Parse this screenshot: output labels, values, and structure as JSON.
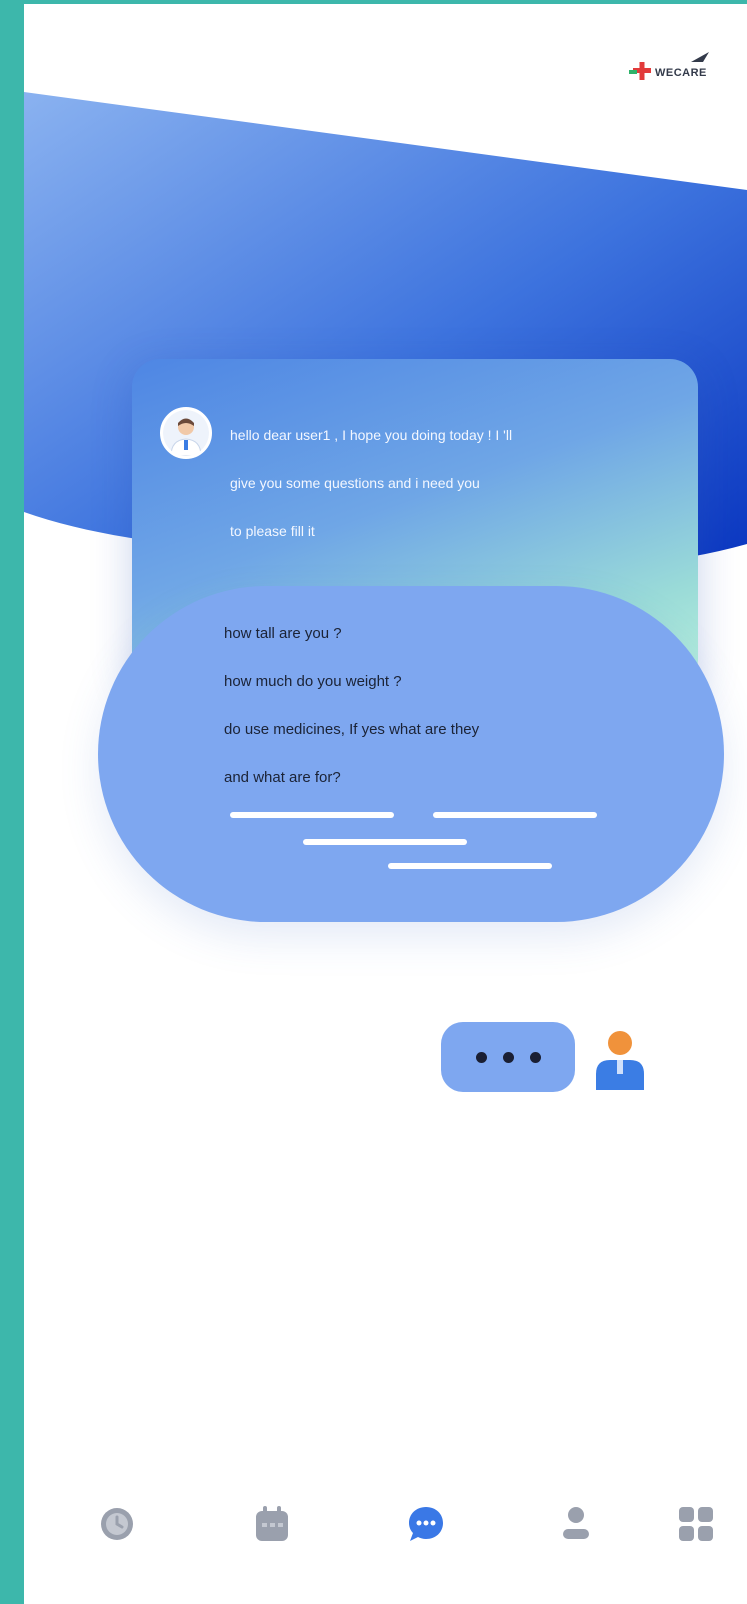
{
  "brand": {
    "logo_text": "WECARE"
  },
  "bot_message": {
    "lines": [
      "hello dear user1 , I hope you doing today ! I 'll",
      "give you some questions and i need you",
      "to please fill it"
    ]
  },
  "questions": [
    "how tall are you ?",
    "how much do you weight ?",
    "do use medicines, If yes what are they",
    "and what are for?"
  ],
  "typing_indicator": {
    "dot_count": 3
  },
  "nav": {
    "items": [
      {
        "icon": "clock-icon",
        "active": false
      },
      {
        "icon": "calendar-icon",
        "active": false
      },
      {
        "icon": "chat-icon",
        "active": true
      },
      {
        "icon": "profile-icon",
        "active": false
      },
      {
        "icon": "grid-menu-icon",
        "active": false
      }
    ]
  },
  "colors": {
    "frame": "#3db7ab",
    "hero_start": "#7aa8ee",
    "hero_end": "#0f3fc8",
    "bubble": "#7ea7f0",
    "nav_inactive": "#9aa0ad",
    "nav_active": "#3a78e6",
    "user_orange": "#f0923b",
    "user_blue": "#3b7de4"
  }
}
